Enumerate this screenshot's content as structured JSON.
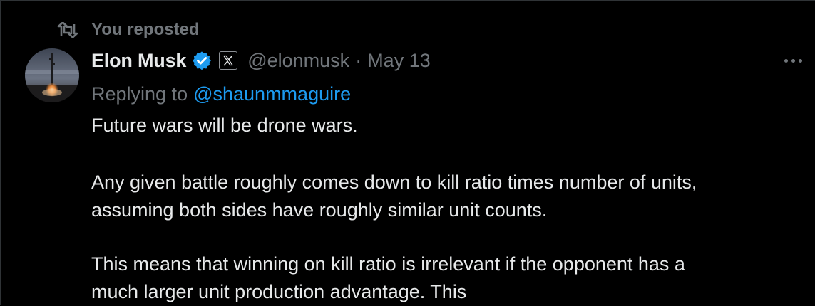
{
  "repost": {
    "label": "You reposted",
    "icon": "repost-icon"
  },
  "author": {
    "display_name": "Elon Musk",
    "handle": "@elonmusk",
    "separator": "·",
    "date": "May 13",
    "verified_icon": "verified-badge-icon",
    "affiliate_icon": "x-logo-icon",
    "verified_color": "#1d9bf0"
  },
  "reply": {
    "label": "Replying to",
    "handle": "@shaunmmaguire"
  },
  "tweet": {
    "paragraphs": [
      "Future wars will be drone wars.",
      "Any given battle roughly comes down to kill ratio times number of units,",
      "assuming both sides have roughly similar unit counts.",
      "This means that winning on kill ratio is irrelevant if the opponent has a",
      "much larger unit production advantage. This"
    ]
  },
  "colors": {
    "background": "#000000",
    "primary_text": "#e7e9ea",
    "secondary_text": "#71767b",
    "link": "#1d9bf0"
  }
}
